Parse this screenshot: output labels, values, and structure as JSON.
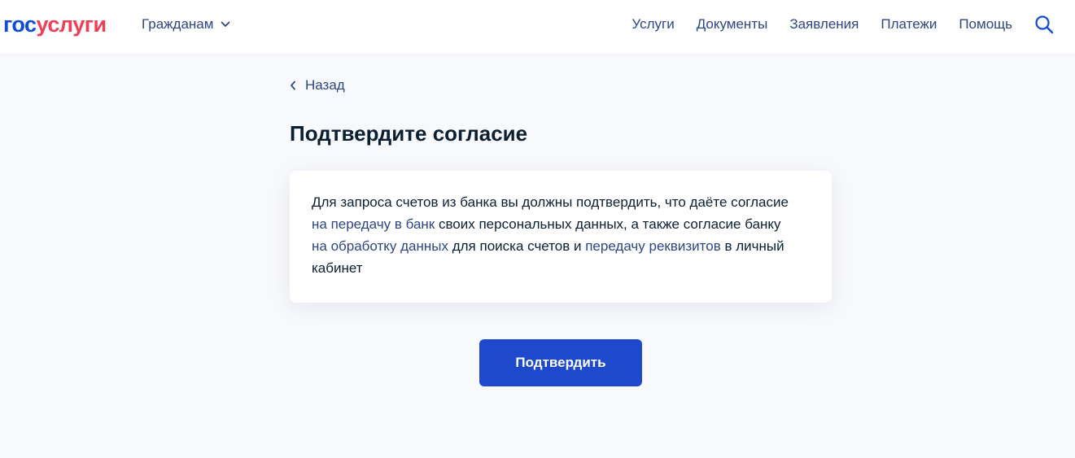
{
  "header": {
    "logo": {
      "part1": "гос",
      "part2": "услуги"
    },
    "audience_label": "Гражданам",
    "nav": [
      {
        "label": "Услуги"
      },
      {
        "label": "Документы"
      },
      {
        "label": "Заявления"
      },
      {
        "label": "Платежи"
      },
      {
        "label": "Помощь"
      }
    ],
    "search_icon": "search-icon",
    "chevron_icon": "chevron-down-icon"
  },
  "back": {
    "label": "Назад",
    "icon": "chevron-left-icon"
  },
  "page": {
    "title": "Подтвердите согласие"
  },
  "consent": {
    "text_1": "Для запроса счетов из банка вы должны подтвердить, что даёте согласие ",
    "link_1": "на передачу в банк",
    "text_2": " своих персональных данных, а также согласие банку ",
    "link_2": "на обработку данных",
    "text_3": " для поиска счетов и ",
    "link_3": "передачу реквизитов",
    "text_4": " в личный кабинет"
  },
  "actions": {
    "confirm_label": "Подтвердить"
  },
  "colors": {
    "brand_blue": "#0d4cd3",
    "brand_red": "#ee3f58",
    "link": "#2d4585",
    "primary_button": "#1e49cc",
    "background": "#f8f9fd",
    "text": "#0b1f33"
  }
}
